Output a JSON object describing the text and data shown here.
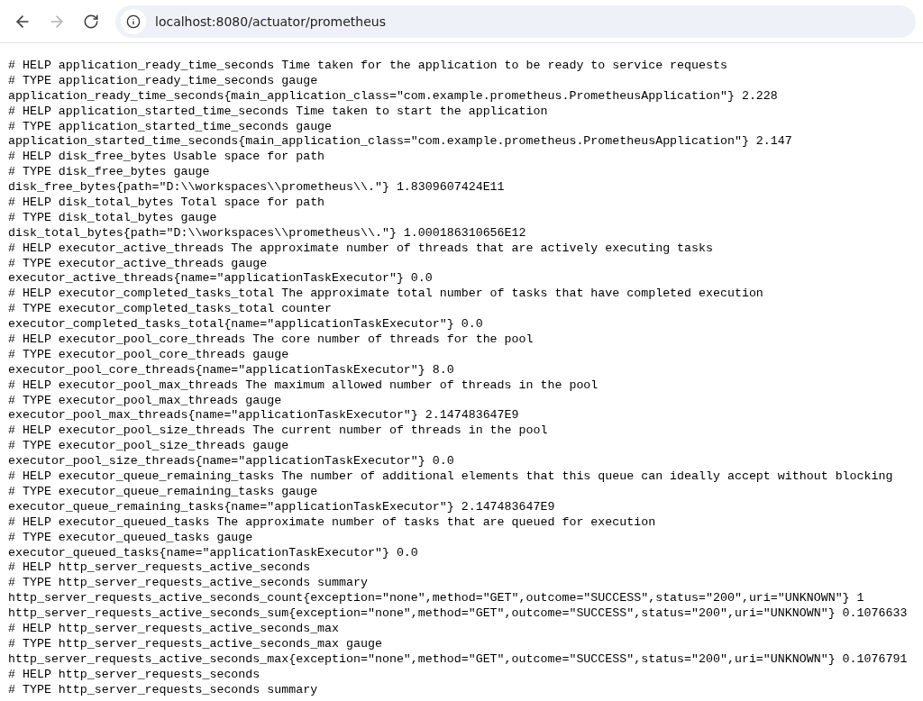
{
  "toolbar": {
    "back": {
      "disabled": false
    },
    "forward": {
      "disabled": true
    },
    "url": "localhost:8080/actuator/prometheus"
  },
  "lines": [
    "# HELP application_ready_time_seconds Time taken for the application to be ready to service requests",
    "# TYPE application_ready_time_seconds gauge",
    "application_ready_time_seconds{main_application_class=\"com.example.prometheus.PrometheusApplication\"} 2.228",
    "# HELP application_started_time_seconds Time taken to start the application",
    "# TYPE application_started_time_seconds gauge",
    "application_started_time_seconds{main_application_class=\"com.example.prometheus.PrometheusApplication\"} 2.147",
    "# HELP disk_free_bytes Usable space for path",
    "# TYPE disk_free_bytes gauge",
    "disk_free_bytes{path=\"D:\\\\workspaces\\\\prometheus\\\\.\"} 1.8309607424E11",
    "# HELP disk_total_bytes Total space for path",
    "# TYPE disk_total_bytes gauge",
    "disk_total_bytes{path=\"D:\\\\workspaces\\\\prometheus\\\\.\"} 1.000186310656E12",
    "# HELP executor_active_threads The approximate number of threads that are actively executing tasks",
    "# TYPE executor_active_threads gauge",
    "executor_active_threads{name=\"applicationTaskExecutor\"} 0.0",
    "# HELP executor_completed_tasks_total The approximate total number of tasks that have completed execution",
    "# TYPE executor_completed_tasks_total counter",
    "executor_completed_tasks_total{name=\"applicationTaskExecutor\"} 0.0",
    "# HELP executor_pool_core_threads The core number of threads for the pool",
    "# TYPE executor_pool_core_threads gauge",
    "executor_pool_core_threads{name=\"applicationTaskExecutor\"} 8.0",
    "# HELP executor_pool_max_threads The maximum allowed number of threads in the pool",
    "# TYPE executor_pool_max_threads gauge",
    "executor_pool_max_threads{name=\"applicationTaskExecutor\"} 2.147483647E9",
    "# HELP executor_pool_size_threads The current number of threads in the pool",
    "# TYPE executor_pool_size_threads gauge",
    "executor_pool_size_threads{name=\"applicationTaskExecutor\"} 0.0",
    "# HELP executor_queue_remaining_tasks The number of additional elements that this queue can ideally accept without blocking",
    "# TYPE executor_queue_remaining_tasks gauge",
    "executor_queue_remaining_tasks{name=\"applicationTaskExecutor\"} 2.147483647E9",
    "# HELP executor_queued_tasks The approximate number of tasks that are queued for execution",
    "# TYPE executor_queued_tasks gauge",
    "executor_queued_tasks{name=\"applicationTaskExecutor\"} 0.0",
    "# HELP http_server_requests_active_seconds",
    "# TYPE http_server_requests_active_seconds summary",
    "http_server_requests_active_seconds_count{exception=\"none\",method=\"GET\",outcome=\"SUCCESS\",status=\"200\",uri=\"UNKNOWN\"} 1",
    "http_server_requests_active_seconds_sum{exception=\"none\",method=\"GET\",outcome=\"SUCCESS\",status=\"200\",uri=\"UNKNOWN\"} 0.1076633",
    "# HELP http_server_requests_active_seconds_max",
    "# TYPE http_server_requests_active_seconds_max gauge",
    "http_server_requests_active_seconds_max{exception=\"none\",method=\"GET\",outcome=\"SUCCESS\",status=\"200\",uri=\"UNKNOWN\"} 0.1076791",
    "# HELP http_server_requests_seconds",
    "# TYPE http_server_requests_seconds summary"
  ]
}
